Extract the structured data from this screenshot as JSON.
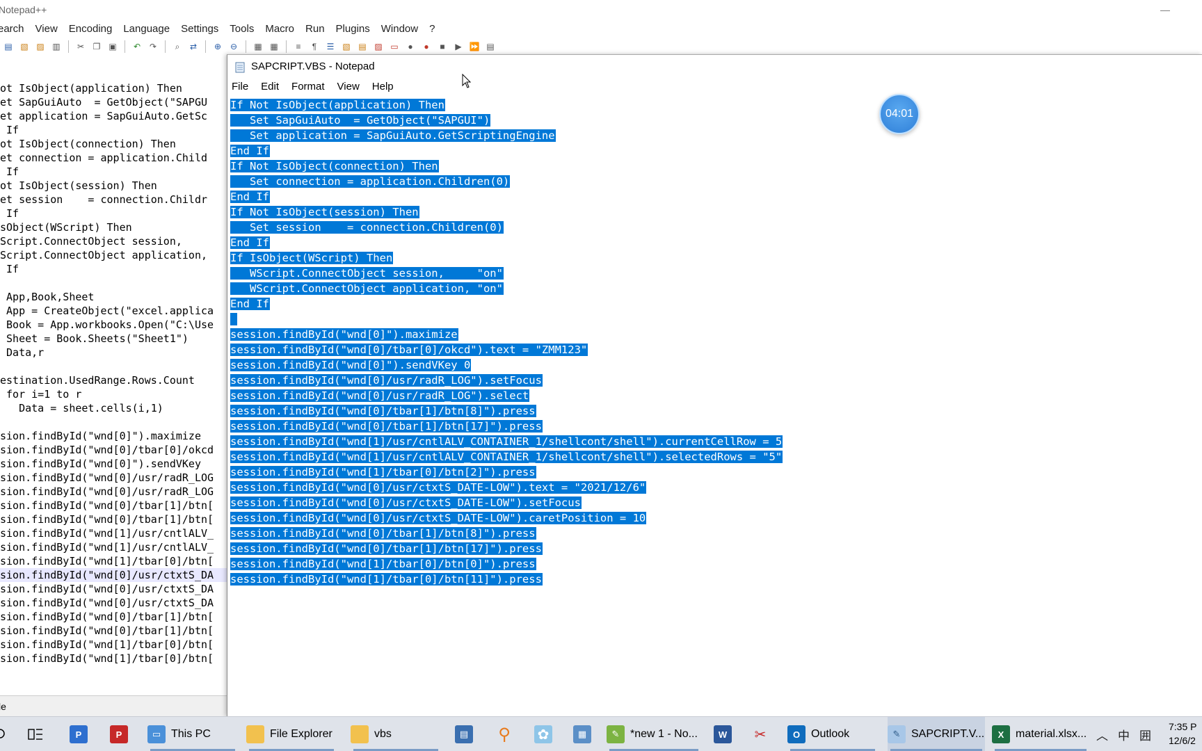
{
  "npp": {
    "title": "Notepad++",
    "minimize_glyph": "—",
    "menu": [
      "earch",
      "View",
      "Encoding",
      "Language",
      "Settings",
      "Tools",
      "Macro",
      "Run",
      "Plugins",
      "Window",
      "?"
    ],
    "code_lines": [
      "ot IsObject(application) Then",
      "et SapGuiAuto  = GetObject(\"SAPGU",
      "et application = SapGuiAuto.GetSc",
      " If",
      "ot IsObject(connection) Then",
      "et connection = application.Child",
      " If",
      "ot IsObject(session) Then",
      "et session    = connection.Childr",
      " If",
      "sObject(WScript) Then",
      "Script.ConnectObject session,    ",
      "Script.ConnectObject application,",
      " If",
      "",
      " App,Book,Sheet",
      " App = CreateObject(\"excel.applica",
      " Book = App.workbooks.Open(\"C:\\Use",
      " Sheet = Book.Sheets(\"Sheet1\")",
      " Data,r",
      "",
      "estination.UsedRange.Rows.Count",
      " for i=1 to r",
      "   Data = sheet.cells(i,1)",
      "",
      "sion.findById(\"wnd[0]\").maximize",
      "sion.findById(\"wnd[0]/tbar[0]/okcd",
      "sion.findById(\"wnd[0]\").sendVKey ",
      "sion.findById(\"wnd[0]/usr/radR_LOG",
      "sion.findById(\"wnd[0]/usr/radR_LOG",
      "sion.findById(\"wnd[0]/tbar[1]/btn[",
      "sion.findById(\"wnd[0]/tbar[1]/btn[",
      "sion.findById(\"wnd[1]/usr/cntlALV_",
      "sion.findById(\"wnd[1]/usr/cntlALV_",
      "sion.findById(\"wnd[1]/tbar[0]/btn[",
      "sion.findById(\"wnd[0]/usr/ctxtS_DA",
      "sion.findById(\"wnd[0]/usr/ctxtS_DA",
      "sion.findById(\"wnd[0]/usr/ctxtS_DA",
      "sion.findById(\"wnd[0]/tbar[1]/btn[",
      "sion.findById(\"wnd[0]/tbar[1]/btn[",
      "sion.findById(\"wnd[1]/tbar[0]/btn[",
      "sion.findById(\"wnd[1]/tbar[0]/btn["
    ],
    "current_line_index": 35,
    "status_text": "le"
  },
  "notepad": {
    "title": "SAPCRIPT.VBS - Notepad",
    "menu": [
      "File",
      "Edit",
      "Format",
      "View",
      "Help"
    ],
    "lines": [
      "If Not IsObject(application) Then",
      "   Set SapGuiAuto  = GetObject(\"SAPGUI\")",
      "   Set application = SapGuiAuto.GetScriptingEngine",
      "End If",
      "If Not IsObject(connection) Then",
      "   Set connection = application.Children(0)",
      "End If",
      "If Not IsObject(session) Then",
      "   Set session    = connection.Children(0)",
      "End If",
      "If IsObject(WScript) Then",
      "   WScript.ConnectObject session,     \"on\"",
      "   WScript.ConnectObject application, \"on\"",
      "End If",
      "",
      "session.findById(\"wnd[0]\").maximize",
      "session.findById(\"wnd[0]/tbar[0]/okcd\").text = \"ZMM123\"",
      "session.findById(\"wnd[0]\").sendVKey 0",
      "session.findById(\"wnd[0]/usr/radR_LOG\").setFocus",
      "session.findById(\"wnd[0]/usr/radR_LOG\").select",
      "session.findById(\"wnd[0]/tbar[1]/btn[8]\").press",
      "session.findById(\"wnd[0]/tbar[1]/btn[17]\").press",
      "session.findById(\"wnd[1]/usr/cntlALV_CONTAINER_1/shellcont/shell\").currentCellRow = 5",
      "session.findById(\"wnd[1]/usr/cntlALV_CONTAINER_1/shellcont/shell\").selectedRows = \"5\"",
      "session.findById(\"wnd[1]/tbar[0]/btn[2]\").press",
      "session.findById(\"wnd[0]/usr/ctxtS_DATE-LOW\").text = \"2021/12/6\"",
      "session.findById(\"wnd[0]/usr/ctxtS_DATE-LOW\").setFocus",
      "session.findById(\"wnd[0]/usr/ctxtS_DATE-LOW\").caretPosition = 10",
      "session.findById(\"wnd[0]/tbar[1]/btn[8]\").press",
      "session.findById(\"wnd[0]/tbar[1]/btn[17]\").press",
      "session.findById(\"wnd[1]/tbar[0]/btn[0]\").press",
      "session.findById(\"wnd[1]/tbar[0]/btn[11]\").press"
    ],
    "selection_color": "#0078d7"
  },
  "timer": {
    "text": "04:01"
  },
  "taskbar": {
    "items": [
      {
        "label": "This PC"
      },
      {
        "label": "File Explorer"
      },
      {
        "label": "vbs"
      },
      {
        "label": "*new 1 - No..."
      },
      {
        "label": "Outlook"
      },
      {
        "label": "SAPCRIPT.V..."
      },
      {
        "label": "material.xlsx..."
      }
    ],
    "tray_ime": "中",
    "tray_grid": "囲",
    "time": "7:35 P",
    "date": "12/6/2"
  }
}
